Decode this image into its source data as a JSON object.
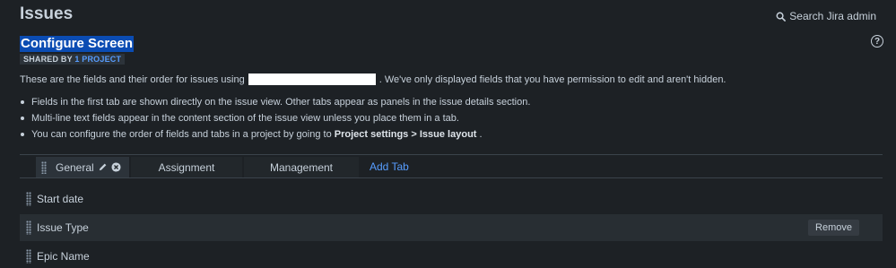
{
  "header": {
    "title": "Issues",
    "search_label": "Search Jira admin"
  },
  "screen": {
    "title": "Configure Screen",
    "shared_prefix": "SHARED BY",
    "shared_link": "1 PROJECT",
    "help_glyph": "?"
  },
  "intro": {
    "before": "These are the fields and their order for issues using",
    "after": ". We've only displayed fields that you have permission to edit and aren't hidden."
  },
  "bullets": [
    {
      "text": "Fields in the first tab are shown directly on the issue view. Other tabs appear as panels in the issue details section."
    },
    {
      "text": "Multi-line text fields appear in the content section of the issue view unless you place them in a tab."
    },
    {
      "before": "You can configure the order of fields and tabs in a project by going to",
      "bold1": "Project settings",
      "sep": ">",
      "bold2": "Issue layout",
      "after": "."
    }
  ],
  "tabs": [
    {
      "label": "General",
      "active": true
    },
    {
      "label": "Assignment",
      "active": false
    },
    {
      "label": "Management",
      "active": false
    }
  ],
  "add_tab_label": "Add Tab",
  "fields": [
    {
      "label": "Start date"
    },
    {
      "label": "Issue Type",
      "action": "Remove"
    },
    {
      "label": "Epic Name"
    }
  ],
  "icons": {
    "search": "search-icon",
    "edit": "pencil-icon",
    "delete": "close-circle-icon",
    "help": "question-circle-icon",
    "drag": "drag-handle-icon"
  },
  "colors": {
    "background": "#1d2125",
    "link": "#579dff",
    "selection": "#0b4cb3"
  }
}
